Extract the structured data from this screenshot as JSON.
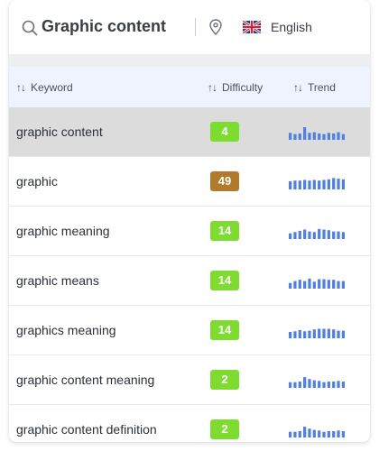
{
  "search": {
    "query": "Graphic content"
  },
  "language": {
    "label": "English"
  },
  "columns": {
    "keyword": "Keyword",
    "difficulty": "Difficulty",
    "trend": "Trend",
    "sort_glyph": "↑↓"
  },
  "colors": {
    "easy": "#7edc30",
    "medium": "#b27a2a",
    "trend": "#4f7fe0",
    "selected_row": "#dcdcdc"
  },
  "rows": [
    {
      "keyword": "graphic content",
      "difficulty": "4",
      "level": "easy",
      "selected": true,
      "trend": [
        0.55,
        0.45,
        0.5,
        1.0,
        0.55,
        0.6,
        0.5,
        0.45,
        0.55,
        0.5,
        0.6,
        0.45
      ]
    },
    {
      "keyword": "graphic",
      "difficulty": "49",
      "level": "medium",
      "selected": false,
      "trend": [
        0.65,
        0.7,
        0.7,
        0.75,
        0.7,
        0.75,
        0.7,
        0.75,
        0.8,
        0.9,
        0.85,
        0.8
      ]
    },
    {
      "keyword": "graphic meaning",
      "difficulty": "14",
      "level": "easy",
      "selected": false,
      "trend": [
        0.45,
        0.55,
        0.65,
        0.75,
        0.6,
        0.55,
        0.8,
        0.75,
        0.7,
        0.6,
        0.6,
        0.55
      ]
    },
    {
      "keyword": "graphic means",
      "difficulty": "14",
      "level": "easy",
      "selected": false,
      "trend": [
        0.45,
        0.6,
        0.7,
        0.6,
        0.8,
        0.55,
        0.75,
        0.75,
        0.7,
        0.7,
        0.6,
        0.6
      ]
    },
    {
      "keyword": "graphics meaning",
      "difficulty": "14",
      "level": "easy",
      "selected": false,
      "trend": [
        0.5,
        0.55,
        0.65,
        0.55,
        0.6,
        0.7,
        0.75,
        0.75,
        0.75,
        0.7,
        0.6,
        0.6
      ]
    },
    {
      "keyword": "graphic content meaning",
      "difficulty": "2",
      "level": "easy",
      "selected": false,
      "trend": [
        0.45,
        0.45,
        0.5,
        0.85,
        0.7,
        0.6,
        0.55,
        0.45,
        0.5,
        0.5,
        0.55,
        0.5
      ]
    },
    {
      "keyword": "graphic content definition",
      "difficulty": "2",
      "level": "easy",
      "selected": false,
      "trend": [
        0.45,
        0.45,
        0.5,
        0.85,
        0.7,
        0.6,
        0.55,
        0.45,
        0.5,
        0.5,
        0.55,
        0.5
      ]
    }
  ]
}
